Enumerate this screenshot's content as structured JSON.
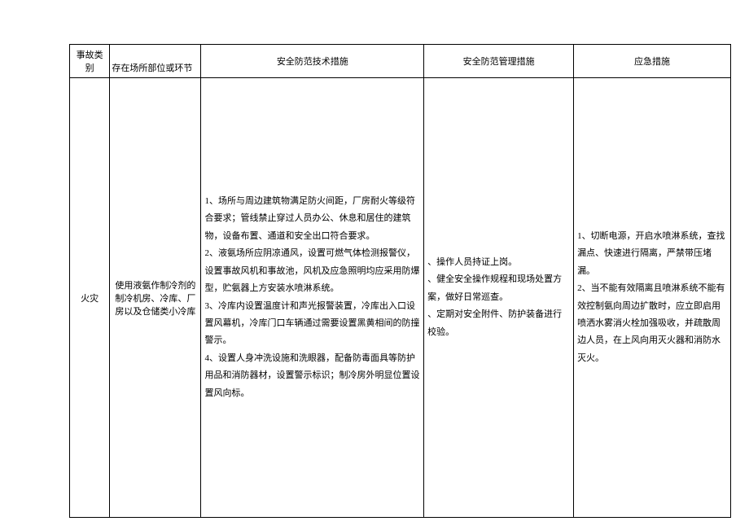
{
  "headers": {
    "accident_type": "事故类别",
    "location": "存在场所部位或环节",
    "tech_measures": "安全防范技术措施",
    "mgmt_measures": "安全防范管理措施",
    "emergency": "应急措施"
  },
  "row": {
    "accident_type": "火灾",
    "location": "使用液氨作制冷剂的制冷机房、冷库、厂房以及仓储类小冷库",
    "tech_measures": "1、场所与周边建筑物满足防火间距，厂房耐火等级符合要求；管线禁止穿过人员办公、休息和居住的建筑物，设备布置、通道和安全出口符合要求。\n2、液氨场所应阴凉通风，设置可燃气体检测报警仪，设置事故风机和事故池，风机及应急照明均应采用防爆型，贮氨器上方安装水喷淋系统。\n3、冷库内设置温度计和声光报警装置，冷库出入口设置风幕机，冷库门口车辆通过需要设置黑黄相间的防撞警示。\n4、设置人身冲洗设施和洗眼器，配备防毒面具等防护用品和消防器材，设置警示标识；制冷房外明显位置设置风向标。",
    "mgmt_measures": "、操作人员持证上岗。\n、健全安全操作规程和现场处置方案，做好日常巡查。\n、定期对安全附件、防护装备进行校验。",
    "emergency": "1、切断电源，开启水喷淋系统，查找漏点、快速进行隔离，严禁带压堵漏。\n2、当不能有效隔离且喷淋系统不能有效控制氨向周边扩散时，应立即启用喷洒水雾消火栓加强吸收，并疏散周边人员，在上风向用灭火器和消防水灭火。"
  }
}
